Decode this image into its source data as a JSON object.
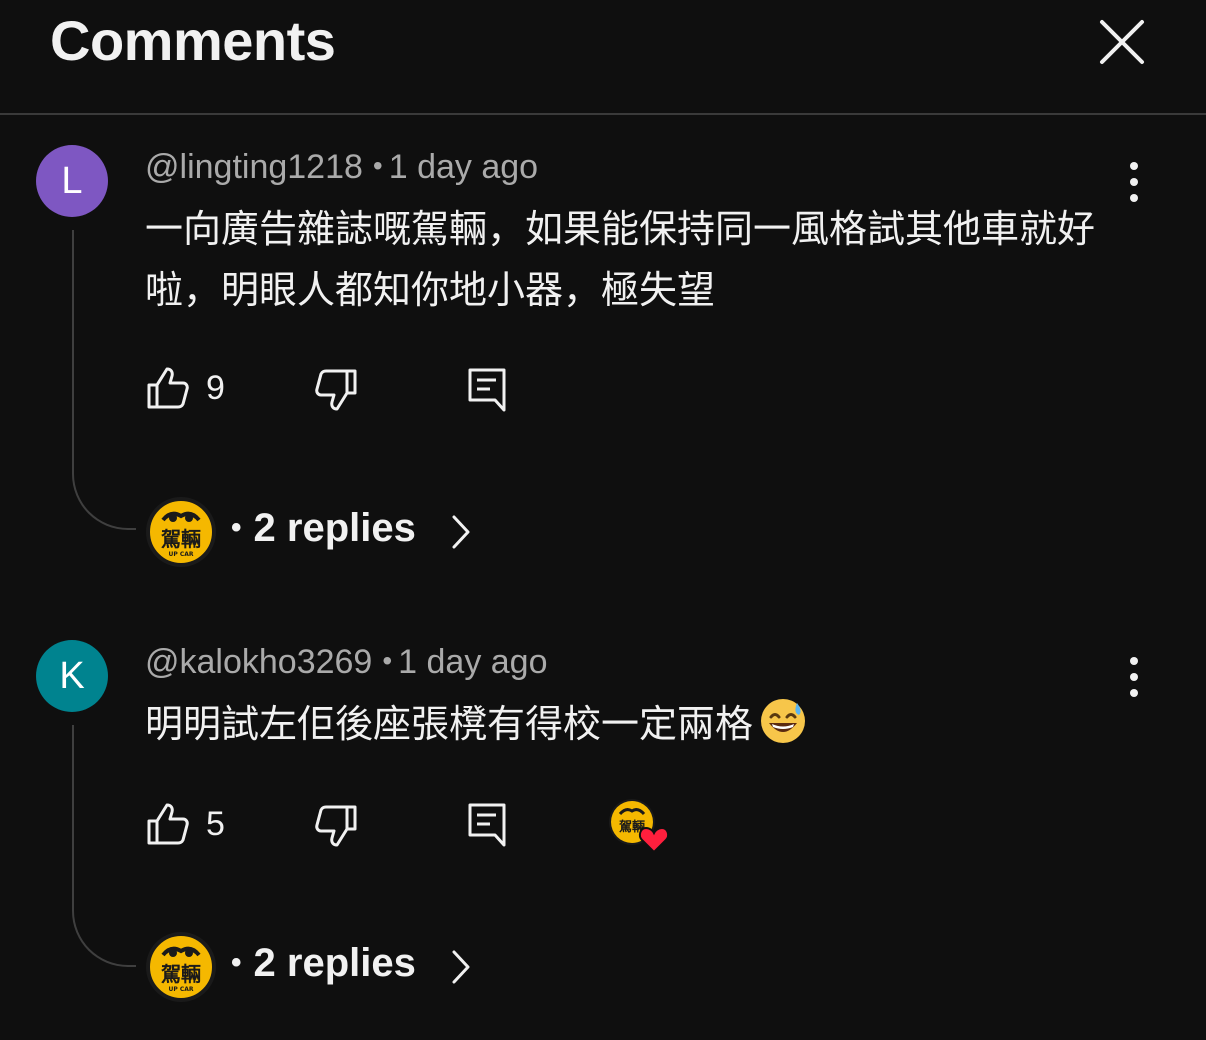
{
  "header": {
    "title": "Comments"
  },
  "comments": [
    {
      "avatar_letter": "L",
      "avatar_color": "#7e57c2",
      "author": "@lingting1218",
      "time": "1 day ago",
      "text": "一向廣告雜誌嘅駕輛，如果能保持同一風格試其他車就好啦，明眼人都知你地小器，極失望",
      "likes": "9",
      "replies_label": "2 replies",
      "has_creator_heart": false
    },
    {
      "avatar_letter": "K",
      "avatar_color": "#00838f",
      "author": "@kalokho3269",
      "time": "1 day ago",
      "text": "明明試左佢後座張櫈有得校一定兩格",
      "emoji": "grinning-face-with-sweat-emoji",
      "likes": "5",
      "replies_label": "2 replies",
      "has_creator_heart": true
    }
  ],
  "channel": {
    "logo_text": "駕輛",
    "logo_subtext": "UP CAR",
    "logo_color": "#f5b800"
  },
  "icons": {
    "close": "close-icon",
    "more": "more-vert-icon",
    "like": "thumbs-up-icon",
    "dislike": "thumbs-down-icon",
    "reply": "reply-comment-icon",
    "chevron": "chevron-right-icon",
    "heart": "heart-icon"
  },
  "colors": {
    "background": "#0f0f0f",
    "text_primary": "#f1f1f1",
    "text_secondary": "#aaaaaa",
    "heart": "#ff1f3d"
  }
}
